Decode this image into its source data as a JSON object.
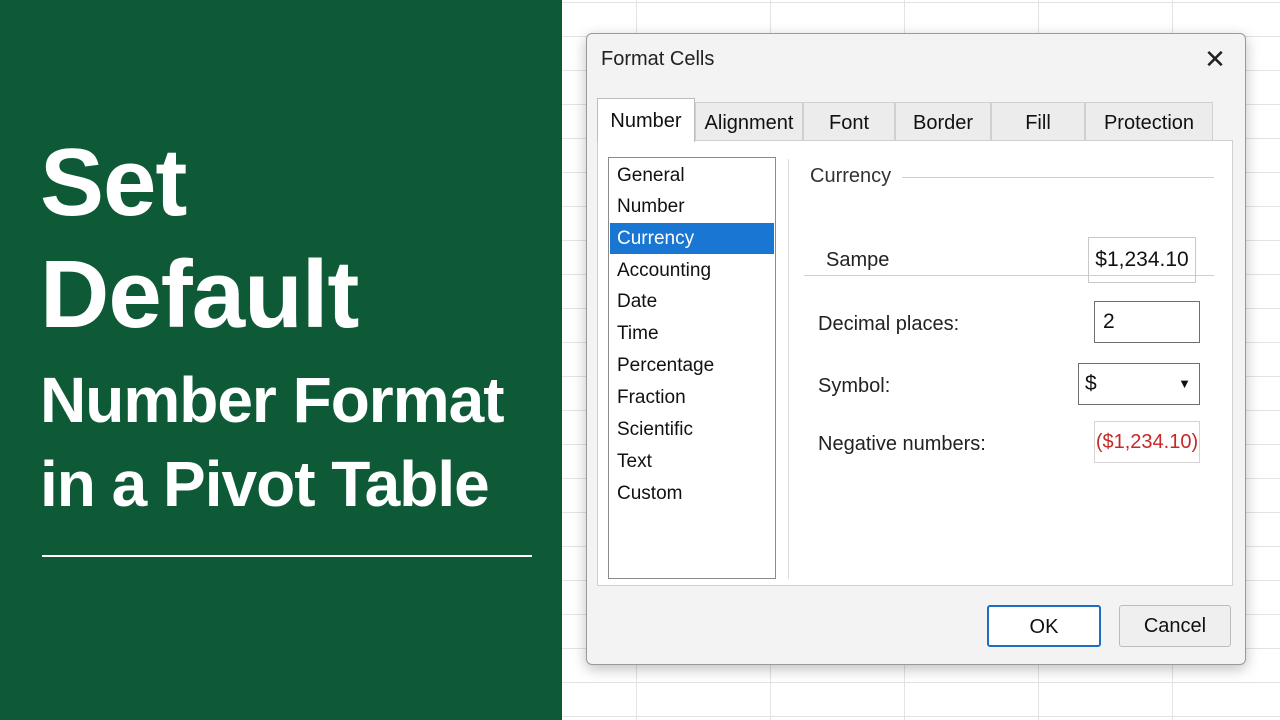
{
  "promo": {
    "title_lines": [
      "Set",
      "Default",
      "Number Format",
      "in a Pivot Table"
    ]
  },
  "dialog": {
    "title": "Format Cells",
    "close_glyph": "✕",
    "tabs": [
      {
        "label": "Number",
        "active": true
      },
      {
        "label": "Alignment"
      },
      {
        "label": "Font"
      },
      {
        "label": "Border"
      },
      {
        "label": "Fill"
      },
      {
        "label": "Protection"
      }
    ],
    "categories": [
      {
        "label": "General"
      },
      {
        "label": "Number"
      },
      {
        "label": "Currency",
        "selected": true
      },
      {
        "label": "Accounting"
      },
      {
        "label": "Date"
      },
      {
        "label": "Time"
      },
      {
        "label": "Percentage"
      },
      {
        "label": "Fraction"
      },
      {
        "label": "Scientific"
      },
      {
        "label": "Text"
      },
      {
        "label": "Custom"
      }
    ],
    "section_label": "Currency",
    "sample": {
      "label": "Sampe",
      "value": "$1,234.10"
    },
    "decimal_places": {
      "label": "Decimal places:",
      "value": "2"
    },
    "symbol": {
      "label": "Symbol:",
      "value": "$",
      "caret": "▼"
    },
    "negative_numbers": {
      "label": "Negative numbers:",
      "value": "($1,234.10)"
    },
    "buttons": {
      "ok": "OK",
      "cancel": "Cancel"
    }
  },
  "colors": {
    "promo_bg": "#0e5a37",
    "selection": "#1976d2",
    "negative_red": "#c62828",
    "ok_border": "#1b6fc2"
  }
}
